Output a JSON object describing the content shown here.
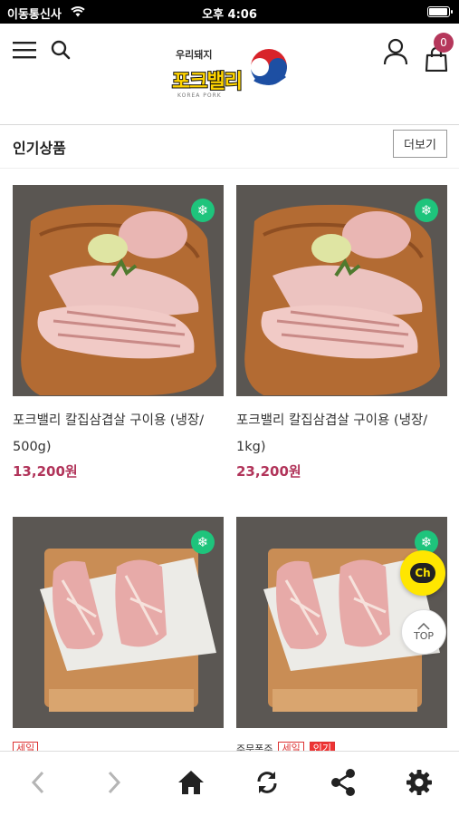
{
  "status_bar": {
    "carrier": "이동통신사",
    "time": "오후 4:06"
  },
  "header": {
    "logo": {
      "top_text": "우리돼지",
      "brand": "포크밸리",
      "sub": "KOREA PORK"
    },
    "cart_count": "0"
  },
  "section": {
    "title": "인기상품",
    "more_label": "더보기"
  },
  "products": [
    {
      "name": "포크밸리 칼집삼겹살 구이용 (냉장/\n500g)",
      "price": "13,200원"
    },
    {
      "name": "포크밸리 칼집삼겹살 구이용 (냉장/\n1kg)",
      "price": "23,200원"
    },
    {
      "name": "",
      "price": ""
    },
    {
      "name": "",
      "price": ""
    }
  ],
  "partial_tags": {
    "left": [
      "세일"
    ],
    "right_prefix": "주문폭주",
    "right": [
      "세일",
      "인기"
    ]
  },
  "floating": {
    "channel_label": "Ch",
    "top_label": "TOP"
  },
  "colors": {
    "price": "#b1345a",
    "badge": "#1ec47c",
    "cart_badge": "#b5375b",
    "channel": "#ffe600"
  },
  "bottom_nav": [
    "chevron-left-icon",
    "chevron-right-icon",
    "home-icon",
    "refresh-icon",
    "share-icon",
    "gear-icon"
  ]
}
